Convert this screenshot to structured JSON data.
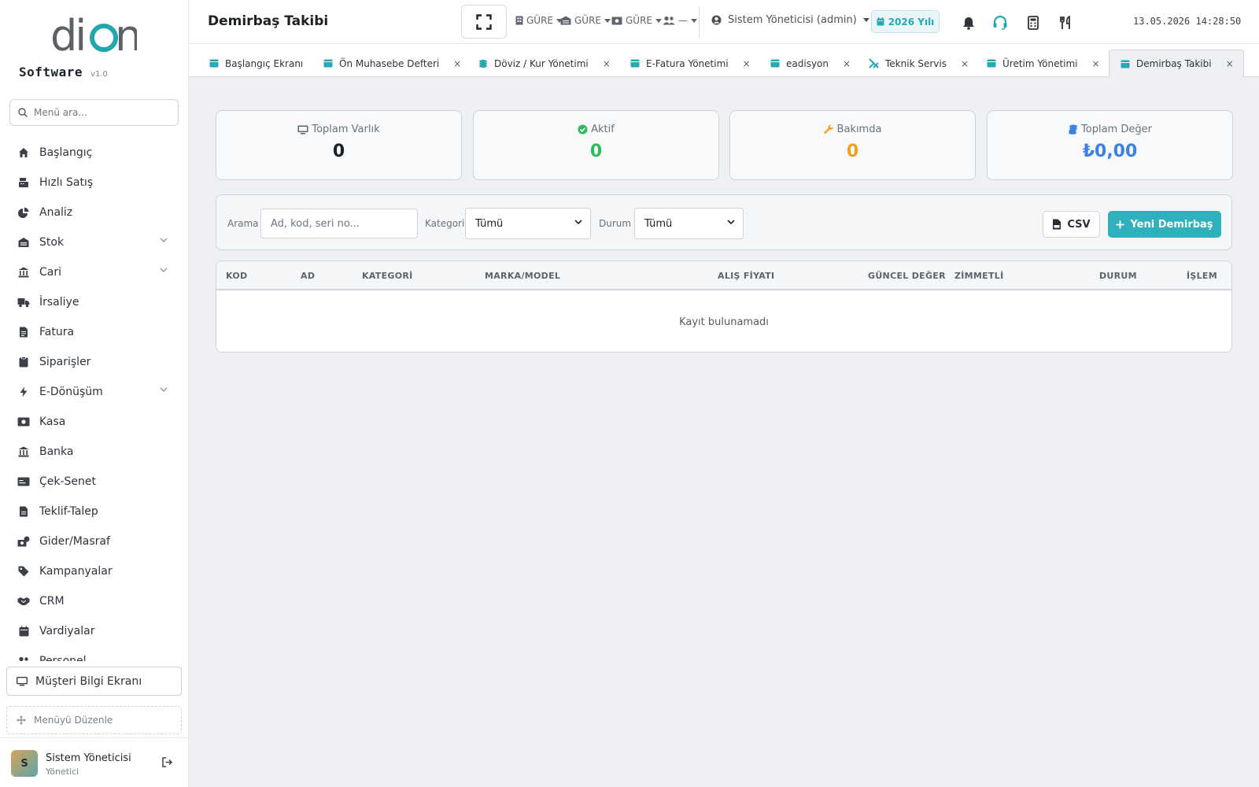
{
  "app": {
    "logo_word": "dion",
    "brand": "Software",
    "version": "v1.0"
  },
  "sidebar": {
    "search_placeholder": "Menü ara...",
    "items": [
      {
        "label": "Başlangıç",
        "icon": "home-icon"
      },
      {
        "label": "Hızlı Satış",
        "icon": "cash-register-icon"
      },
      {
        "label": "Analiz",
        "icon": "pie-chart-icon"
      },
      {
        "label": "Stok",
        "icon": "warehouse-icon",
        "expandable": true
      },
      {
        "label": "Cari",
        "icon": "bank-icon",
        "expandable": true
      },
      {
        "label": "İrsaliye",
        "icon": "truck-icon"
      },
      {
        "label": "Fatura",
        "icon": "invoice-icon"
      },
      {
        "label": "Siparişler",
        "icon": "clipboard-icon"
      },
      {
        "label": "E-Dönüşüm",
        "icon": "bolt-icon",
        "expandable": true
      },
      {
        "label": "Kasa",
        "icon": "money-icon"
      },
      {
        "label": "Banka",
        "icon": "bank-icon"
      },
      {
        "label": "Çek-Senet",
        "icon": "card-icon"
      },
      {
        "label": "Teklif-Talep",
        "icon": "document-icon"
      },
      {
        "label": "Gider/Masraf",
        "icon": "expense-icon"
      },
      {
        "label": "Kampanyalar",
        "icon": "tag-icon"
      },
      {
        "label": "CRM",
        "icon": "handshake-icon"
      },
      {
        "label": "Vardiyalar",
        "icon": "calendar-icon"
      },
      {
        "label": "Personel",
        "icon": "users-icon"
      }
    ],
    "customer_screen_label": "Müşteri Bilgi Ekranı",
    "edit_menu_label": "Menüyü Düzenle",
    "user": {
      "initial": "S",
      "name": "Sistem Yöneticisi",
      "role": "Yönetici"
    }
  },
  "topbar": {
    "page_title": "Demirbaş Takibi",
    "contexts": [
      "GÜRE",
      "GÜRE",
      "GÜRE",
      "—"
    ],
    "user_label": "Sistem Yöneticisi (admin)",
    "year_label": "2026 Yılı",
    "datetime": "13.05.2026 14:28:50"
  },
  "tabs": [
    {
      "label": "Başlangıç Ekranı",
      "closable": false
    },
    {
      "label": "Ön Muhasebe Defteri",
      "closable": true
    },
    {
      "label": "Döviz / Kur Yönetimi",
      "closable": true
    },
    {
      "label": "E-Fatura Yönetimi",
      "closable": true
    },
    {
      "label": "eadisyon",
      "closable": true
    },
    {
      "label": "Teknik Servis",
      "closable": true
    },
    {
      "label": "Üretim Yönetimi",
      "closable": true
    },
    {
      "label": "Demirbaş Takibi",
      "closable": true,
      "active": true
    }
  ],
  "tab_close_glyph": "×",
  "stats": [
    {
      "label": "Toplam Varlık",
      "value": "0",
      "color": "#1d2127",
      "icon": "monitor-icon"
    },
    {
      "label": "Aktif",
      "value": "0",
      "color": "#2dbb5e",
      "icon": "check-circle-icon"
    },
    {
      "label": "Bakımda",
      "value": "0",
      "color": "#f0a020",
      "icon": "wrench-icon"
    },
    {
      "label": "Toplam Değer",
      "value": "₺0,00",
      "color": "#3b82e0",
      "icon": "coins-icon"
    }
  ],
  "filters": {
    "search_label": "Arama",
    "search_placeholder": "Ad, kod, seri no...",
    "category_label": "Kategori",
    "category_value": "Tümü",
    "status_label": "Durum",
    "status_value": "Tümü",
    "csv_label": "CSV",
    "new_label": "Yeni Demirbaş"
  },
  "table": {
    "columns": [
      "KOD",
      "AD",
      "KATEGORİ",
      "MARKA/MODEL",
      "ALIŞ FİYATI",
      "GÜNCEL DEĞER",
      "ZİMMETLİ",
      "DURUM",
      "İŞLEM"
    ],
    "empty_text": "Kayıt bulunamadı"
  },
  "colors": {
    "accent": "#2fb0bc"
  }
}
